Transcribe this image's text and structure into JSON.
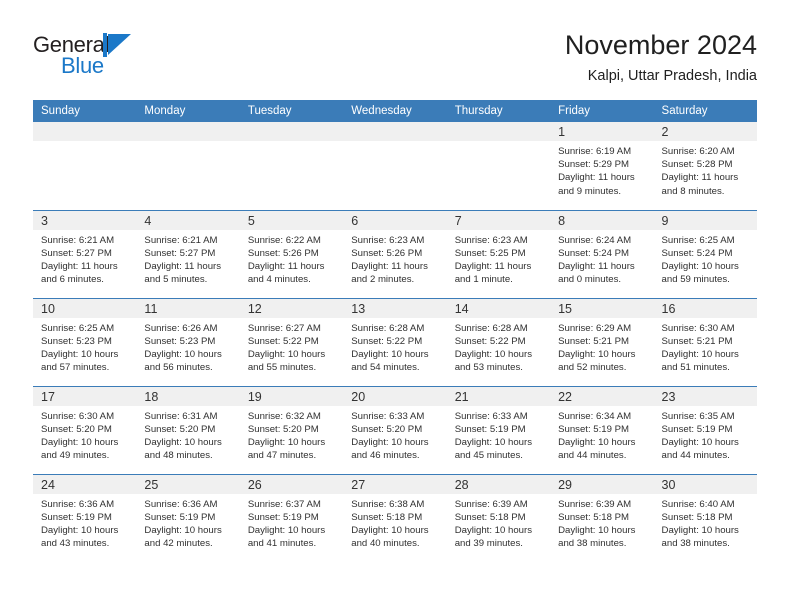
{
  "brand": {
    "name_part1": "General",
    "name_part2": "Blue",
    "logo_icon": "triangle-flag-mark"
  },
  "header": {
    "title": "November 2024",
    "subtitle": "Kalpi, Uttar Pradesh, India"
  },
  "colors": {
    "header_blue": "#3b7cb8",
    "brand_blue": "#1b78c8",
    "daynum_band": "#f0f0f0",
    "text": "#303030"
  },
  "weekday_headers": [
    "Sunday",
    "Monday",
    "Tuesday",
    "Wednesday",
    "Thursday",
    "Friday",
    "Saturday"
  ],
  "weeks": [
    [
      {
        "day": "",
        "empty": true
      },
      {
        "day": "",
        "empty": true
      },
      {
        "day": "",
        "empty": true
      },
      {
        "day": "",
        "empty": true
      },
      {
        "day": "",
        "empty": true
      },
      {
        "day": "1",
        "sunrise": "Sunrise: 6:19 AM",
        "sunset": "Sunset: 5:29 PM",
        "daylight": "Daylight: 11 hours and 9 minutes."
      },
      {
        "day": "2",
        "sunrise": "Sunrise: 6:20 AM",
        "sunset": "Sunset: 5:28 PM",
        "daylight": "Daylight: 11 hours and 8 minutes."
      }
    ],
    [
      {
        "day": "3",
        "sunrise": "Sunrise: 6:21 AM",
        "sunset": "Sunset: 5:27 PM",
        "daylight": "Daylight: 11 hours and 6 minutes."
      },
      {
        "day": "4",
        "sunrise": "Sunrise: 6:21 AM",
        "sunset": "Sunset: 5:27 PM",
        "daylight": "Daylight: 11 hours and 5 minutes."
      },
      {
        "day": "5",
        "sunrise": "Sunrise: 6:22 AM",
        "sunset": "Sunset: 5:26 PM",
        "daylight": "Daylight: 11 hours and 4 minutes."
      },
      {
        "day": "6",
        "sunrise": "Sunrise: 6:23 AM",
        "sunset": "Sunset: 5:26 PM",
        "daylight": "Daylight: 11 hours and 2 minutes."
      },
      {
        "day": "7",
        "sunrise": "Sunrise: 6:23 AM",
        "sunset": "Sunset: 5:25 PM",
        "daylight": "Daylight: 11 hours and 1 minute."
      },
      {
        "day": "8",
        "sunrise": "Sunrise: 6:24 AM",
        "sunset": "Sunset: 5:24 PM",
        "daylight": "Daylight: 11 hours and 0 minutes."
      },
      {
        "day": "9",
        "sunrise": "Sunrise: 6:25 AM",
        "sunset": "Sunset: 5:24 PM",
        "daylight": "Daylight: 10 hours and 59 minutes."
      }
    ],
    [
      {
        "day": "10",
        "sunrise": "Sunrise: 6:25 AM",
        "sunset": "Sunset: 5:23 PM",
        "daylight": "Daylight: 10 hours and 57 minutes."
      },
      {
        "day": "11",
        "sunrise": "Sunrise: 6:26 AM",
        "sunset": "Sunset: 5:23 PM",
        "daylight": "Daylight: 10 hours and 56 minutes."
      },
      {
        "day": "12",
        "sunrise": "Sunrise: 6:27 AM",
        "sunset": "Sunset: 5:22 PM",
        "daylight": "Daylight: 10 hours and 55 minutes."
      },
      {
        "day": "13",
        "sunrise": "Sunrise: 6:28 AM",
        "sunset": "Sunset: 5:22 PM",
        "daylight": "Daylight: 10 hours and 54 minutes."
      },
      {
        "day": "14",
        "sunrise": "Sunrise: 6:28 AM",
        "sunset": "Sunset: 5:22 PM",
        "daylight": "Daylight: 10 hours and 53 minutes."
      },
      {
        "day": "15",
        "sunrise": "Sunrise: 6:29 AM",
        "sunset": "Sunset: 5:21 PM",
        "daylight": "Daylight: 10 hours and 52 minutes."
      },
      {
        "day": "16",
        "sunrise": "Sunrise: 6:30 AM",
        "sunset": "Sunset: 5:21 PM",
        "daylight": "Daylight: 10 hours and 51 minutes."
      }
    ],
    [
      {
        "day": "17",
        "sunrise": "Sunrise: 6:30 AM",
        "sunset": "Sunset: 5:20 PM",
        "daylight": "Daylight: 10 hours and 49 minutes."
      },
      {
        "day": "18",
        "sunrise": "Sunrise: 6:31 AM",
        "sunset": "Sunset: 5:20 PM",
        "daylight": "Daylight: 10 hours and 48 minutes."
      },
      {
        "day": "19",
        "sunrise": "Sunrise: 6:32 AM",
        "sunset": "Sunset: 5:20 PM",
        "daylight": "Daylight: 10 hours and 47 minutes."
      },
      {
        "day": "20",
        "sunrise": "Sunrise: 6:33 AM",
        "sunset": "Sunset: 5:20 PM",
        "daylight": "Daylight: 10 hours and 46 minutes."
      },
      {
        "day": "21",
        "sunrise": "Sunrise: 6:33 AM",
        "sunset": "Sunset: 5:19 PM",
        "daylight": "Daylight: 10 hours and 45 minutes."
      },
      {
        "day": "22",
        "sunrise": "Sunrise: 6:34 AM",
        "sunset": "Sunset: 5:19 PM",
        "daylight": "Daylight: 10 hours and 44 minutes."
      },
      {
        "day": "23",
        "sunrise": "Sunrise: 6:35 AM",
        "sunset": "Sunset: 5:19 PM",
        "daylight": "Daylight: 10 hours and 44 minutes."
      }
    ],
    [
      {
        "day": "24",
        "sunrise": "Sunrise: 6:36 AM",
        "sunset": "Sunset: 5:19 PM",
        "daylight": "Daylight: 10 hours and 43 minutes."
      },
      {
        "day": "25",
        "sunrise": "Sunrise: 6:36 AM",
        "sunset": "Sunset: 5:19 PM",
        "daylight": "Daylight: 10 hours and 42 minutes."
      },
      {
        "day": "26",
        "sunrise": "Sunrise: 6:37 AM",
        "sunset": "Sunset: 5:19 PM",
        "daylight": "Daylight: 10 hours and 41 minutes."
      },
      {
        "day": "27",
        "sunrise": "Sunrise: 6:38 AM",
        "sunset": "Sunset: 5:18 PM",
        "daylight": "Daylight: 10 hours and 40 minutes."
      },
      {
        "day": "28",
        "sunrise": "Sunrise: 6:39 AM",
        "sunset": "Sunset: 5:18 PM",
        "daylight": "Daylight: 10 hours and 39 minutes."
      },
      {
        "day": "29",
        "sunrise": "Sunrise: 6:39 AM",
        "sunset": "Sunset: 5:18 PM",
        "daylight": "Daylight: 10 hours and 38 minutes."
      },
      {
        "day": "30",
        "sunrise": "Sunrise: 6:40 AM",
        "sunset": "Sunset: 5:18 PM",
        "daylight": "Daylight: 10 hours and 38 minutes."
      }
    ]
  ]
}
